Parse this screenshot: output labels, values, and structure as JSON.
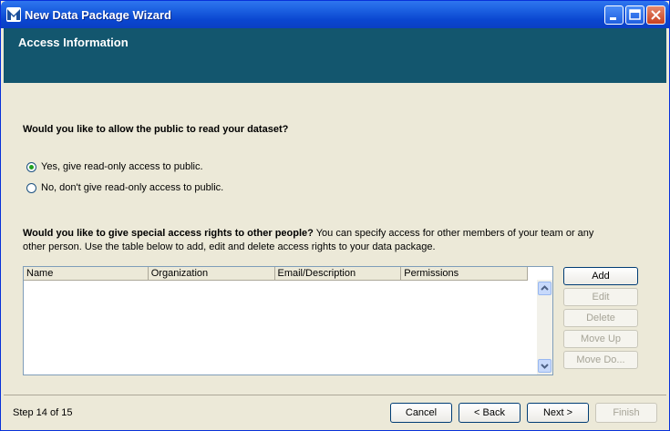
{
  "window": {
    "title": "New Data Package Wizard",
    "controls": {
      "minimize": "minimize-icon",
      "maximize": "maximize-icon",
      "close": "close-icon"
    }
  },
  "header": {
    "title": "Access Information"
  },
  "public_access": {
    "question": "Would you like to allow the public to read your dataset?",
    "options": [
      {
        "label": "Yes, give read-only access to public.",
        "selected": true
      },
      {
        "label": "No, don't give read-only access to public.",
        "selected": false
      }
    ]
  },
  "special_access": {
    "question_bold": "Would you like to give special access rights to other people?",
    "question_rest": " You can specify access for other members of your team or any other person. Use the table below to add, edit and delete access rights to your data package.",
    "columns": [
      "Name",
      "Organization",
      "Email/Description",
      "Permissions"
    ],
    "rows": []
  },
  "side_buttons": {
    "add": "Add",
    "edit": "Edit",
    "delete": "Delete",
    "move_up": "Move Up",
    "move_down": "Move Do..."
  },
  "footer": {
    "step": "Step 14 of 15",
    "cancel": "Cancel",
    "back": "< Back",
    "next": "Next >",
    "finish": "Finish"
  },
  "colors": {
    "header_band": "#13566e",
    "titlebar": "#0a46d0",
    "dialog_bg": "#ece9d8"
  }
}
